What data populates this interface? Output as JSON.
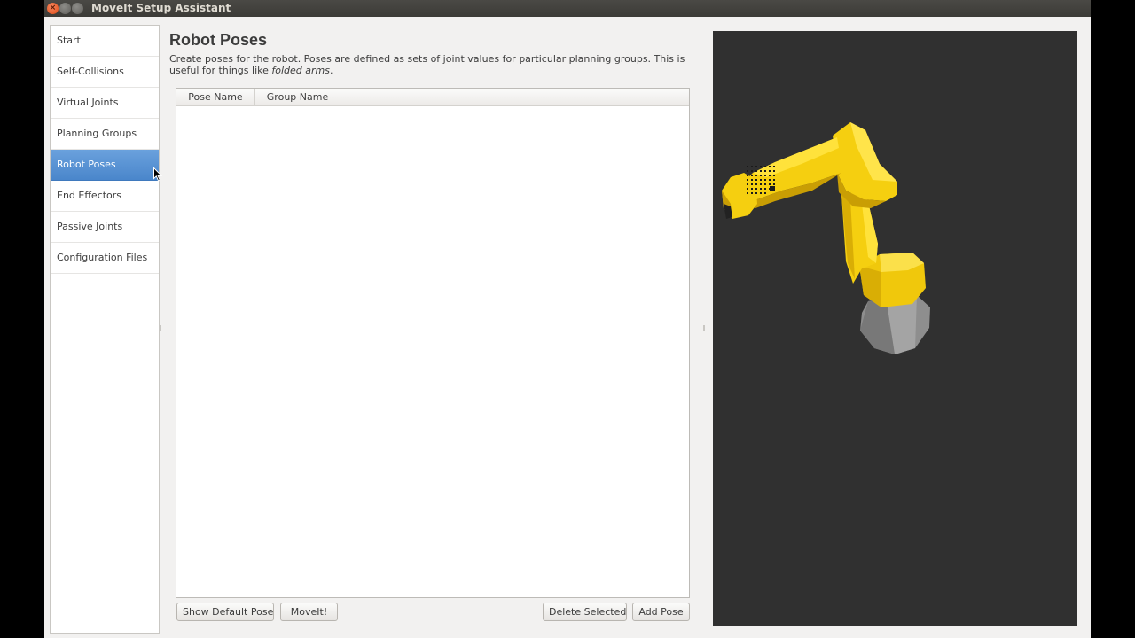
{
  "window": {
    "title": "MoveIt Setup Assistant",
    "close_glyph": "×"
  },
  "nav": {
    "items": [
      {
        "label": "Start"
      },
      {
        "label": "Self-Collisions"
      },
      {
        "label": "Virtual Joints"
      },
      {
        "label": "Planning Groups"
      },
      {
        "label": "Robot Poses"
      },
      {
        "label": "End Effectors"
      },
      {
        "label": "Passive Joints"
      },
      {
        "label": "Configuration Files"
      }
    ],
    "active_index": 4
  },
  "page": {
    "title": "Robot Poses",
    "description_prefix": "Create poses for the robot. Poses are defined as sets of joint values for particular planning groups. This is useful for things like ",
    "description_emphasis": "folded arms",
    "description_suffix": "."
  },
  "table": {
    "columns": [
      "Pose Name",
      "Group Name"
    ],
    "rows": []
  },
  "buttons": {
    "show_default_pose": "Show Default Pose",
    "moveit": "MoveIt!",
    "delete_selected": "Delete Selected",
    "add_pose": "Add Pose"
  },
  "colors": {
    "selection": "#4a86cb",
    "viewport_bg": "#303030",
    "robot_yellow": "#f5d20f",
    "robot_base": "#8c8c8c"
  },
  "icons": {
    "cursor": "mouse-pointer-icon",
    "robot": "robot-arm-model"
  }
}
